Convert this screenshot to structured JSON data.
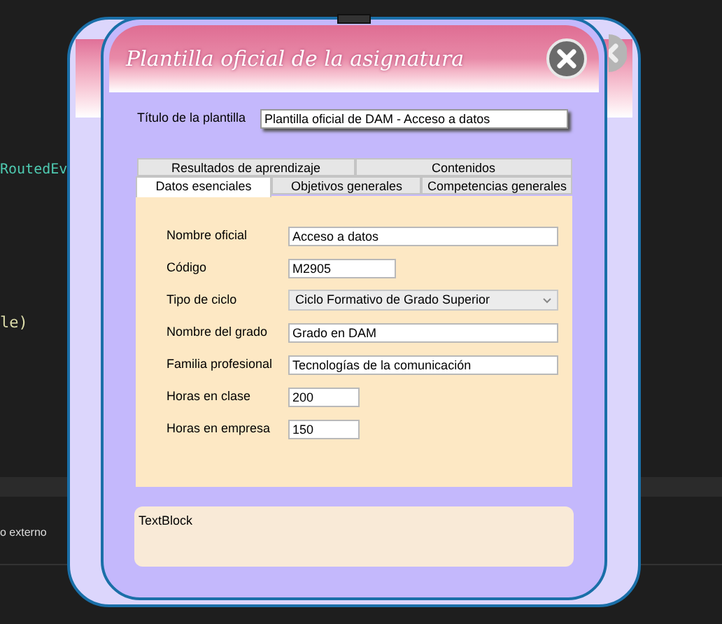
{
  "editor": {
    "code_lines": [
      "RoutedEv",
      "le)"
    ],
    "status_text": "o externo"
  },
  "window": {
    "title": "Plantilla oficial de la asignatura"
  },
  "template_title": {
    "label": "Título de la plantilla",
    "value": "Plantilla oficial de DAM - Acceso a datos"
  },
  "tab_rows": [
    [
      {
        "label": "Resultados de aprendizaje",
        "selected": false
      },
      {
        "label": "Contenidos",
        "selected": false
      }
    ],
    [
      {
        "label": "Datos esenciales",
        "selected": true
      },
      {
        "label": "Objetivos generales",
        "selected": false
      },
      {
        "label": "Competencias generales",
        "selected": false
      }
    ]
  ],
  "fields": [
    {
      "label": "Nombre oficial",
      "value": "Acceso a datos",
      "kind": "text"
    },
    {
      "label": "Código",
      "value": "M2905",
      "kind": "medium"
    },
    {
      "label": "Tipo de ciclo",
      "value": "Ciclo Formativo de Grado Superior",
      "kind": "combo"
    },
    {
      "label": "Nombre del grado",
      "value": "Grado en DAM",
      "kind": "text"
    },
    {
      "label": "Familia profesional",
      "value": "Tecnologías de la comunicación",
      "kind": "text"
    },
    {
      "label": "Horas en clase",
      "value": "200",
      "kind": "short"
    },
    {
      "label": "Horas en empresa",
      "value": "150",
      "kind": "short"
    }
  ],
  "text_block": "TextBlock"
}
